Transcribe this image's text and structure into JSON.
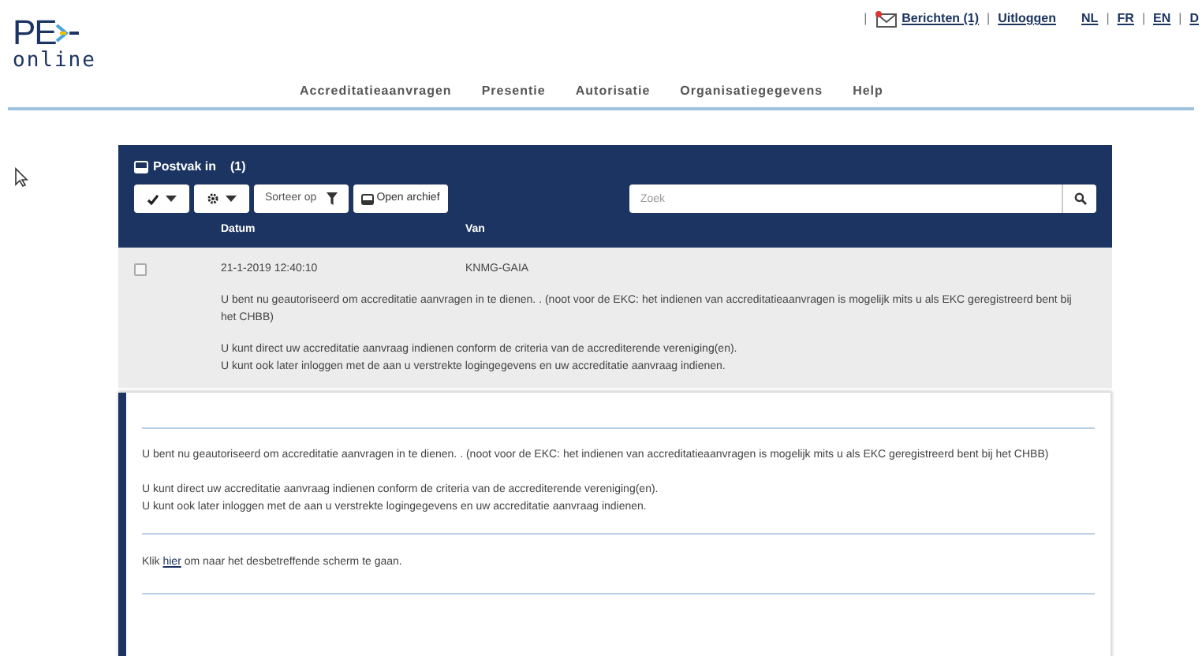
{
  "logo": {
    "mark": "PE",
    "sub": "online"
  },
  "top_links": [
    {
      "kind": "separator",
      "text": "|"
    },
    {
      "kind": "message-link",
      "text": "Berichten (1)"
    },
    {
      "kind": "separator",
      "text": "|"
    },
    {
      "kind": "link",
      "text": "Uitloggen"
    },
    {
      "kind": "gap"
    },
    {
      "kind": "link",
      "text": "NL"
    },
    {
      "kind": "separator",
      "text": "|"
    },
    {
      "kind": "link",
      "text": "FR"
    },
    {
      "kind": "separator",
      "text": "|"
    },
    {
      "kind": "link",
      "text": "EN"
    },
    {
      "kind": "separator",
      "text": "|"
    },
    {
      "kind": "link",
      "text": "D"
    }
  ],
  "nav": [
    "Accreditatieaanvragen",
    "Presentie",
    "Autorisatie",
    "Organisatiegegevens",
    "Help"
  ],
  "inbox": {
    "title": "Postvak in",
    "count": "(1)",
    "sort_button": "Sorteer op",
    "archive_button": "Open archief",
    "search": {
      "placeholder": "Zoek"
    },
    "columns": [
      "Datum",
      "Van"
    ]
  },
  "messages": [
    {
      "checked": false,
      "date": "21-1-2019 12:40:10",
      "from": "KNMG-GAIA",
      "paragraphs": [
        "U bent nu geautoriseerd om accreditatie aanvragen in te dienen. . (noot voor de EKC: het indienen van accreditatieaanvragen is mogelijk mits u als EKC geregistreerd bent bij het CHBB)",
        "U kunt direct uw accreditatie aanvraag indienen conform de criteria van de accrediterende vereniging(en).\nU kunt ook later inloggen met de aan u verstrekte logingegevens en uw accreditatie aanvraag indienen."
      ]
    }
  ],
  "detail": {
    "paragraphs": [
      "U bent nu geautoriseerd om accreditatie aanvragen in te dienen. . (noot voor de EKC: het indienen van accreditatieaanvragen is mogelijk mits u als EKC geregistreerd bent bij het CHBB)",
      "U kunt direct uw accreditatie aanvraag indienen conform de criteria van de accrediterende vereniging(en).\nU kunt ook later inloggen met de aan u verstrekte logingegevens en uw accreditatie aanvraag indienen."
    ],
    "link_sentence": {
      "before": "Klik ",
      "link": "hier",
      "after": " om naar het desbetreffende scherm te gaan."
    }
  }
}
